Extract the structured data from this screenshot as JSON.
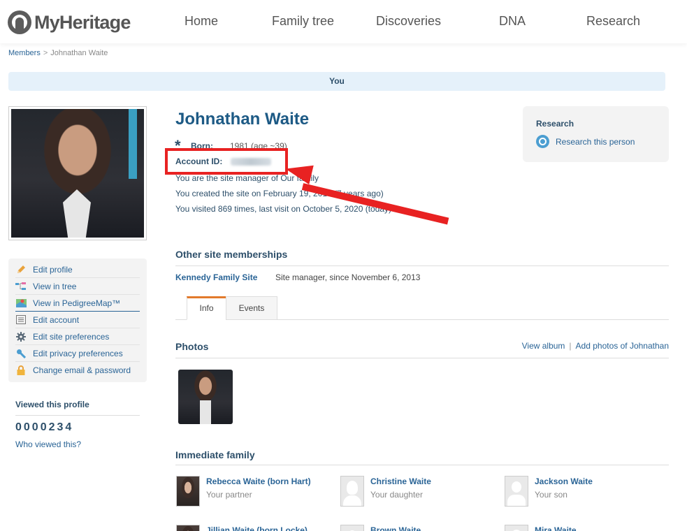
{
  "brand": {
    "logo_text": "MyHeritage"
  },
  "nav": [
    "Home",
    "Family tree",
    "Discoveries",
    "DNA",
    "Research"
  ],
  "breadcrumb": {
    "root": "Members",
    "separator": ">",
    "current": "Johnathan Waite"
  },
  "you_bar": "You",
  "profile": {
    "name": "Johnathan Waite",
    "born_label": "Born:",
    "born_value": "1981 (age ~39)",
    "account_id_label": "Account ID:",
    "manager_text": "You are the site manager of Our family",
    "created_text": "You created the site on February 19, 2013 (7 years ago)",
    "visited_text": "You visited 869 times, last visit on October 5, 2020 (today)"
  },
  "side_menu": [
    {
      "label": "Edit profile",
      "icon": "pencil-icon"
    },
    {
      "label": "View in tree",
      "icon": "tree-icon"
    },
    {
      "label": "View in PedigreeMap™",
      "icon": "map-icon"
    },
    {
      "label": "Edit account",
      "icon": "list-icon"
    },
    {
      "label": "Edit site preferences",
      "icon": "gear-icon"
    },
    {
      "label": "Edit privacy preferences",
      "icon": "wrench-icon"
    },
    {
      "label": "Change email & password",
      "icon": "lock-icon"
    }
  ],
  "viewed": {
    "title": "Viewed this profile",
    "count": "0000234",
    "link": "Who viewed this?"
  },
  "research": {
    "title": "Research",
    "link": "Research this person"
  },
  "memberships": {
    "title": "Other site memberships",
    "site": "Kennedy Family Site",
    "role": "Site manager, since November 6, 2013"
  },
  "tabs": [
    "Info",
    "Events"
  ],
  "photos": {
    "title": "Photos",
    "view_album": "View album",
    "divider": "|",
    "add_photos": "Add photos of Johnathan"
  },
  "family": {
    "title": "Immediate family",
    "members": [
      {
        "name": "Rebecca Waite (born Hart)",
        "relation": "Your partner"
      },
      {
        "name": "Christine Waite",
        "relation": "Your daughter"
      },
      {
        "name": "Jackson Waite",
        "relation": "Your son"
      },
      {
        "name": "Jillian Waite (born Locke)",
        "relation": ""
      },
      {
        "name": "Brown Waite",
        "relation": ""
      },
      {
        "name": "Mira Waite",
        "relation": ""
      }
    ]
  },
  "colors": {
    "brand_blue": "#1d5a85",
    "link_blue": "#2a6496",
    "annotation_red": "#e82222",
    "tab_accent": "#e27a2c"
  }
}
